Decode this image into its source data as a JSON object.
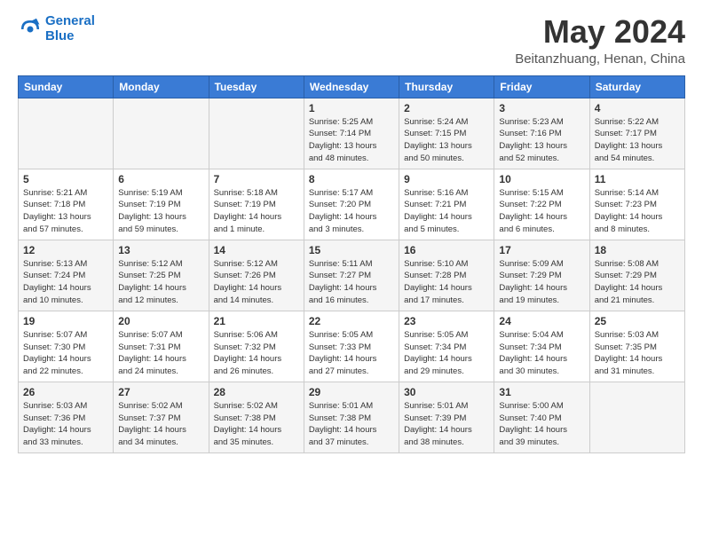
{
  "header": {
    "logo_line1": "General",
    "logo_line2": "Blue",
    "title": "May 2024",
    "subtitle": "Beitanzhuang, Henan, China"
  },
  "days_of_week": [
    "Sunday",
    "Monday",
    "Tuesday",
    "Wednesday",
    "Thursday",
    "Friday",
    "Saturday"
  ],
  "weeks": [
    [
      {
        "day": "",
        "info": ""
      },
      {
        "day": "",
        "info": ""
      },
      {
        "day": "",
        "info": ""
      },
      {
        "day": "1",
        "info": "Sunrise: 5:25 AM\nSunset: 7:14 PM\nDaylight: 13 hours\nand 48 minutes."
      },
      {
        "day": "2",
        "info": "Sunrise: 5:24 AM\nSunset: 7:15 PM\nDaylight: 13 hours\nand 50 minutes."
      },
      {
        "day": "3",
        "info": "Sunrise: 5:23 AM\nSunset: 7:16 PM\nDaylight: 13 hours\nand 52 minutes."
      },
      {
        "day": "4",
        "info": "Sunrise: 5:22 AM\nSunset: 7:17 PM\nDaylight: 13 hours\nand 54 minutes."
      }
    ],
    [
      {
        "day": "5",
        "info": "Sunrise: 5:21 AM\nSunset: 7:18 PM\nDaylight: 13 hours\nand 57 minutes."
      },
      {
        "day": "6",
        "info": "Sunrise: 5:19 AM\nSunset: 7:19 PM\nDaylight: 13 hours\nand 59 minutes."
      },
      {
        "day": "7",
        "info": "Sunrise: 5:18 AM\nSunset: 7:19 PM\nDaylight: 14 hours\nand 1 minute."
      },
      {
        "day": "8",
        "info": "Sunrise: 5:17 AM\nSunset: 7:20 PM\nDaylight: 14 hours\nand 3 minutes."
      },
      {
        "day": "9",
        "info": "Sunrise: 5:16 AM\nSunset: 7:21 PM\nDaylight: 14 hours\nand 5 minutes."
      },
      {
        "day": "10",
        "info": "Sunrise: 5:15 AM\nSunset: 7:22 PM\nDaylight: 14 hours\nand 6 minutes."
      },
      {
        "day": "11",
        "info": "Sunrise: 5:14 AM\nSunset: 7:23 PM\nDaylight: 14 hours\nand 8 minutes."
      }
    ],
    [
      {
        "day": "12",
        "info": "Sunrise: 5:13 AM\nSunset: 7:24 PM\nDaylight: 14 hours\nand 10 minutes."
      },
      {
        "day": "13",
        "info": "Sunrise: 5:12 AM\nSunset: 7:25 PM\nDaylight: 14 hours\nand 12 minutes."
      },
      {
        "day": "14",
        "info": "Sunrise: 5:12 AM\nSunset: 7:26 PM\nDaylight: 14 hours\nand 14 minutes."
      },
      {
        "day": "15",
        "info": "Sunrise: 5:11 AM\nSunset: 7:27 PM\nDaylight: 14 hours\nand 16 minutes."
      },
      {
        "day": "16",
        "info": "Sunrise: 5:10 AM\nSunset: 7:28 PM\nDaylight: 14 hours\nand 17 minutes."
      },
      {
        "day": "17",
        "info": "Sunrise: 5:09 AM\nSunset: 7:29 PM\nDaylight: 14 hours\nand 19 minutes."
      },
      {
        "day": "18",
        "info": "Sunrise: 5:08 AM\nSunset: 7:29 PM\nDaylight: 14 hours\nand 21 minutes."
      }
    ],
    [
      {
        "day": "19",
        "info": "Sunrise: 5:07 AM\nSunset: 7:30 PM\nDaylight: 14 hours\nand 22 minutes."
      },
      {
        "day": "20",
        "info": "Sunrise: 5:07 AM\nSunset: 7:31 PM\nDaylight: 14 hours\nand 24 minutes."
      },
      {
        "day": "21",
        "info": "Sunrise: 5:06 AM\nSunset: 7:32 PM\nDaylight: 14 hours\nand 26 minutes."
      },
      {
        "day": "22",
        "info": "Sunrise: 5:05 AM\nSunset: 7:33 PM\nDaylight: 14 hours\nand 27 minutes."
      },
      {
        "day": "23",
        "info": "Sunrise: 5:05 AM\nSunset: 7:34 PM\nDaylight: 14 hours\nand 29 minutes."
      },
      {
        "day": "24",
        "info": "Sunrise: 5:04 AM\nSunset: 7:34 PM\nDaylight: 14 hours\nand 30 minutes."
      },
      {
        "day": "25",
        "info": "Sunrise: 5:03 AM\nSunset: 7:35 PM\nDaylight: 14 hours\nand 31 minutes."
      }
    ],
    [
      {
        "day": "26",
        "info": "Sunrise: 5:03 AM\nSunset: 7:36 PM\nDaylight: 14 hours\nand 33 minutes."
      },
      {
        "day": "27",
        "info": "Sunrise: 5:02 AM\nSunset: 7:37 PM\nDaylight: 14 hours\nand 34 minutes."
      },
      {
        "day": "28",
        "info": "Sunrise: 5:02 AM\nSunset: 7:38 PM\nDaylight: 14 hours\nand 35 minutes."
      },
      {
        "day": "29",
        "info": "Sunrise: 5:01 AM\nSunset: 7:38 PM\nDaylight: 14 hours\nand 37 minutes."
      },
      {
        "day": "30",
        "info": "Sunrise: 5:01 AM\nSunset: 7:39 PM\nDaylight: 14 hours\nand 38 minutes."
      },
      {
        "day": "31",
        "info": "Sunrise: 5:00 AM\nSunset: 7:40 PM\nDaylight: 14 hours\nand 39 minutes."
      },
      {
        "day": "",
        "info": ""
      }
    ]
  ]
}
